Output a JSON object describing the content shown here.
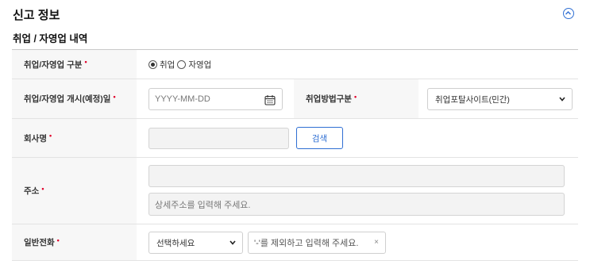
{
  "section": {
    "title": "신고 정보",
    "subtitle": "취업 / 자영업 내역"
  },
  "accent_color": "#2f6fd3",
  "required_color": "#e0002a",
  "rows": {
    "type": {
      "label": "취업/자영업 구분",
      "options": [
        "취업",
        "자영업"
      ],
      "selected": "취업"
    },
    "start_date": {
      "label": "취업/자영업 개시(예정)일",
      "placeholder": "YYYY-MM-DD",
      "method_label": "취업방법구분",
      "method_value": "취업포탈사이트(민간)"
    },
    "company": {
      "label": "회사명",
      "value": "",
      "search_label": "검색"
    },
    "address": {
      "label": "주소",
      "line1": "",
      "detail_placeholder": "상세주소를 입력해 주세요."
    },
    "phone": {
      "label": "일반전화",
      "area_select": "선택하세요",
      "placeholder": "'-'를 제외하고 입력해 주세요.",
      "clear": "×"
    }
  },
  "required_mark": "•"
}
